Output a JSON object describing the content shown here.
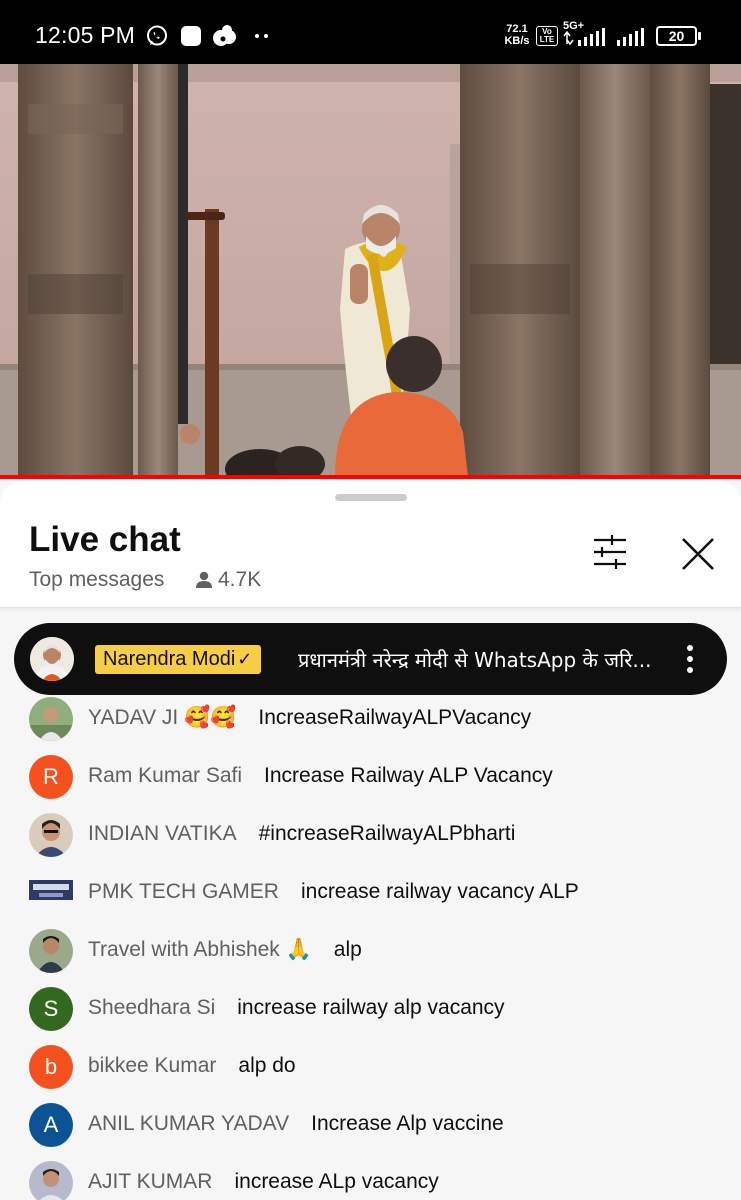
{
  "status_bar": {
    "time": "12:05 PM",
    "net_speed_value": "72.1",
    "net_speed_unit": "KB/s",
    "volte_label": "Vo LTE",
    "network_label": "5G+",
    "battery": "20",
    "icons": [
      "whatsapp-icon",
      "app-icon",
      "cloud-icon",
      "more-dots-icon",
      "signal-icon",
      "battery-icon"
    ]
  },
  "video": {
    "progress_color": "#ff0000"
  },
  "chat": {
    "title": "Live chat",
    "mode": "Top messages",
    "viewer_count": "4.7K",
    "icons": [
      "filter-icon",
      "close-icon",
      "viewer-icon",
      "more-vert-icon"
    ],
    "pinned": {
      "author": "Narendra Modi",
      "verified": "✓",
      "text": "प्रधानमंत्री नरेन्द्र मोदी से WhatsApp के जरि..."
    },
    "messages": [
      {
        "author": "YADAV JI 🥰🥰",
        "text": "IncreaseRailwayALPVacancy",
        "avatar_type": "photo",
        "avatar_color": "#7a9b6a"
      },
      {
        "author": "Ram Kumar Safi",
        "text": "Increase Railway ALP Vacancy",
        "avatar_type": "letter",
        "avatar_letter": "R",
        "avatar_color": "#f4511e"
      },
      {
        "author": "INDIAN VATIKA",
        "text": "#increaseRailwayALPbharti",
        "avatar_type": "photo",
        "avatar_color": "#c8b8a6"
      },
      {
        "author": "PMK TECH GAMER",
        "text": "increase railway vacancy ALP",
        "avatar_type": "photo",
        "avatar_color": "#2d3a66"
      },
      {
        "author": "Travel with Abhishek 🙏",
        "text": "alp",
        "avatar_type": "photo",
        "avatar_color": "#6e7d5a"
      },
      {
        "author": "Sheedhara Si",
        "text": "increase railway alp vacancy",
        "avatar_type": "letter",
        "avatar_letter": "S",
        "avatar_color": "#33691e"
      },
      {
        "author": "bikkee Kumar",
        "text": "alp do",
        "avatar_type": "letter",
        "avatar_letter": "b",
        "avatar_color": "#f4511e"
      },
      {
        "author": "ANIL KUMAR YADAV",
        "text": "Increase Alp vaccine",
        "avatar_type": "letter",
        "avatar_letter": "A",
        "avatar_color": "#0b5394"
      },
      {
        "author": "AJIT KUMAR",
        "text": "increase ALp vacancy",
        "avatar_type": "photo",
        "avatar_color": "#8e8ea8"
      }
    ]
  }
}
